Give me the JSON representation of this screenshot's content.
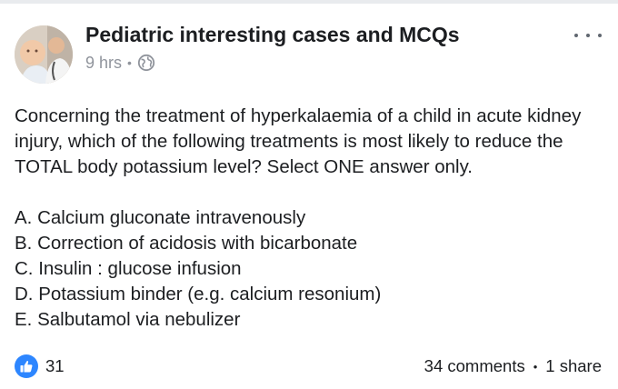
{
  "post": {
    "page_name": "Pediatric interesting cases and MCQs",
    "timestamp": "9 hrs",
    "privacy_icon": "globe-icon",
    "question": "Concerning the treatment of hyperkalaemia of a child in acute kidney injury, which of the following treatments is most likely to reduce the TOTAL body potassium level? Select ONE answer only.",
    "options": [
      "A. Calcium gluconate intravenously",
      "B. Correction of acidosis with bicarbonate",
      "C. Insulin : glucose infusion",
      "D. Potassium binder (e.g. calcium resonium)",
      "E. Salbutamol via nebulizer"
    ]
  },
  "footer": {
    "reaction_icon": "like-icon",
    "reaction_count": "31",
    "comments": "34 comments",
    "shares": "1 share"
  },
  "colors": {
    "text": "#1c1e21",
    "meta": "#90949c",
    "like_blue": "#2d86ff"
  }
}
